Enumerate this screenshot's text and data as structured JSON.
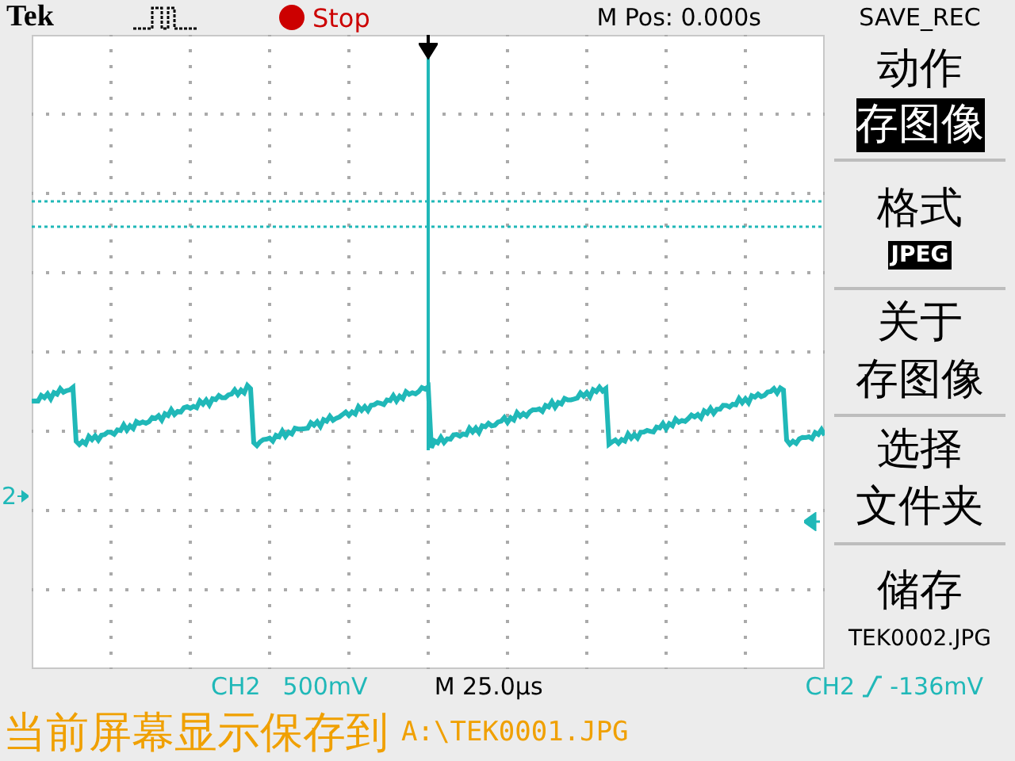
{
  "top_bar": {
    "brand": "Tek",
    "acquisition": {
      "state": "Stop",
      "color": "#cc0000"
    },
    "position": "M Pos: 0.000s",
    "menu_title": "SAVE_REC"
  },
  "display": {
    "ground_marker": "2"
  },
  "menu": [
    {
      "lines": [
        {
          "text": "动作",
          "kind": "label"
        },
        {
          "text": "存图像",
          "kind": "inverse"
        }
      ]
    },
    {
      "lines": [
        {
          "text": "格式",
          "kind": "label"
        },
        {
          "text": "JPEG",
          "kind": "badge"
        }
      ]
    },
    {
      "lines": [
        {
          "text": "关于",
          "kind": "label"
        },
        {
          "text": "存图像",
          "kind": "label"
        }
      ]
    },
    {
      "lines": [
        {
          "text": "选择",
          "kind": "label"
        },
        {
          "text": "文件夹",
          "kind": "label"
        }
      ]
    },
    {
      "lines": [
        {
          "text": "储存",
          "kind": "label"
        },
        {
          "text": "TEK0002.JPG",
          "kind": "small"
        }
      ]
    }
  ],
  "status_bar": {
    "channel": "CH2",
    "scale": "500mV",
    "timebase": "M 25.0µs",
    "trigger_channel": "CH2",
    "trigger_level": "-136mV"
  },
  "message": {
    "text": "当前屏幕显示保存到",
    "path": "A:\\TEK0001.JPG"
  }
}
